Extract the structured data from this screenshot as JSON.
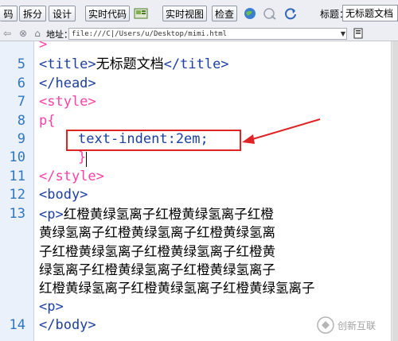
{
  "toolbar": {
    "code_btn": "码",
    "split_btn": "拆分",
    "design_btn": "设计",
    "live_code_btn": "实时代码",
    "live_view_btn": "实时视图",
    "inspect_btn": "检查",
    "title_label": "标题：",
    "title_value": "无标题文档"
  },
  "address": {
    "label": "地址：",
    "value": "file:///C|/Users/u/Desktop/mimi.html"
  },
  "editor": {
    "line_numbers": [
      "5",
      "6",
      "7",
      "8",
      "9",
      "10",
      "11",
      "12",
      "13",
      "14"
    ],
    "line4_partial": ">",
    "line5": {
      "open": "<title>",
      "text": "无标题文档",
      "close": "</title>"
    },
    "line6": "</head>",
    "line7": "<style>",
    "line8": "p{",
    "line9": "text-indent:2em;",
    "line10": "}",
    "line11": "</style>",
    "line12": "<body>",
    "line13_open": "<p>",
    "line13_text": "红橙黄绿氢离子红橙黄绿氢离子红橙",
    "wrap1": "黄绿氢离子红橙黄绿氢离子红橙黄绿氢离",
    "wrap2": "子红橙黄绿氢离子红橙黄绿氢离子红橙黄",
    "wrap3": "绿氢离子红橙黄绿氢离子红橙黄绿氢离子",
    "wrap4": "红橙黄绿氢离子红橙黄绿氢离子红橙黄绿氢离子",
    "wrap5": "<p>",
    "line14_partial": "</body>"
  },
  "watermark": {
    "text": "创新互联",
    "icon": "logo-icon"
  },
  "colors": {
    "tag": "#1b3fa0",
    "style_tag": "#ff3fa6",
    "line_number": "#2f76c2",
    "highlight": "#e02424"
  }
}
